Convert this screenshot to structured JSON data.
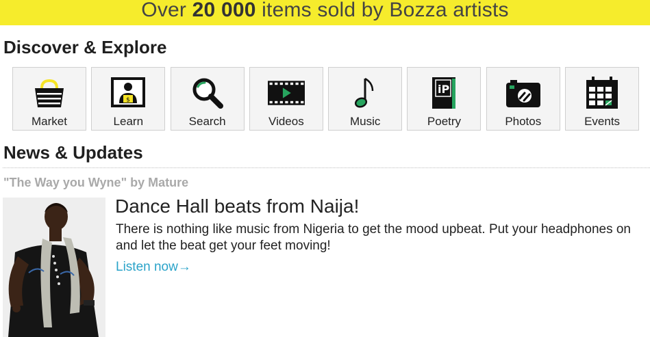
{
  "banner": {
    "prefix": "Over",
    "count": "20 000",
    "suffix": "items sold by Bozza artists"
  },
  "discover": {
    "heading": "Discover & Explore",
    "tiles": [
      {
        "label": "Market",
        "icon": "basket-icon"
      },
      {
        "label": "Learn",
        "icon": "learn-icon"
      },
      {
        "label": "Search",
        "icon": "search-icon"
      },
      {
        "label": "Videos",
        "icon": "video-icon"
      },
      {
        "label": "Music",
        "icon": "music-note-icon"
      },
      {
        "label": "Poetry",
        "icon": "poetry-book-icon"
      },
      {
        "label": "Photos",
        "icon": "camera-icon"
      },
      {
        "label": "Events",
        "icon": "calendar-icon"
      }
    ]
  },
  "news": {
    "heading": "News & Updates",
    "item": {
      "caption": "\"The Way you Wyne\" by Mature",
      "title": "Dance Hall beats from Naija!",
      "body": "There is nothing like music from Nigeria to get the mood upbeat. Put your headphones on and let the beat get your feet moving!",
      "link_label": "Listen now→"
    }
  },
  "colors": {
    "banner": "#f6ec2c",
    "accent_green": "#27a55f",
    "link": "#2aa3c9"
  }
}
